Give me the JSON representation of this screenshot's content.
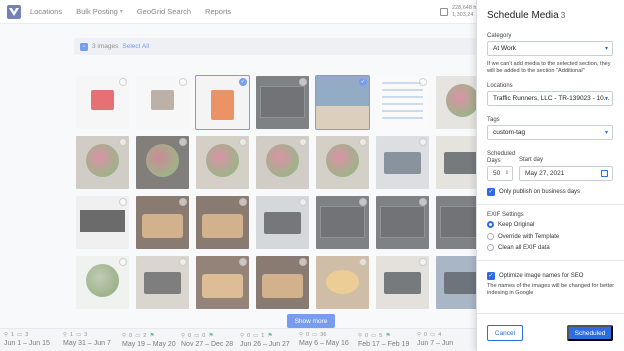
{
  "nav": {
    "items": [
      {
        "label": "Locations",
        "dropdown": false
      },
      {
        "label": "Bulk Posting",
        "dropdown": true
      },
      {
        "label": "GeoGrid Search",
        "dropdown": false
      },
      {
        "label": "Reports",
        "dropdown": false
      }
    ],
    "stat_line_1": "228,648 h",
    "stat_line_2": "1,303,24"
  },
  "selection": {
    "count_label": "3 images",
    "select_all_label": "Select All"
  },
  "media_grid": {
    "rows": [
      [
        {
          "subject": "red-top",
          "color": "#f2f2f2",
          "accent": "#d7262b",
          "selected": false
        },
        {
          "subject": "snake-print-top",
          "color": "#f3f3f3",
          "accent": "#9a8878",
          "selected": false
        },
        {
          "subject": "orange-skirt",
          "color": "#efefef",
          "accent": "#e05a14",
          "selected": true
        },
        {
          "subject": "video-dark",
          "color": "#3b3f44",
          "accent": "#26292d",
          "selected": false
        },
        {
          "subject": "landscape",
          "color": "#5a7fa6",
          "accent": "#c9b79a",
          "selected": true
        },
        {
          "subject": "infographic",
          "color": "#f7f7f9",
          "accent": "#7fa9d6",
          "selected": false
        },
        {
          "subject": "bouquet",
          "color": "#d9d6cf",
          "accent": "#c75a7a",
          "selected": false
        }
      ],
      [
        {
          "subject": "bouquet",
          "color": "#b8b3a8",
          "accent": "#c75a7a",
          "selected": false
        },
        {
          "subject": "bouquet-dark",
          "color": "#3e3a36",
          "accent": "#b04b5f",
          "selected": false
        },
        {
          "subject": "bouquet",
          "color": "#bdb7ab",
          "accent": "#c75a7a",
          "selected": false
        },
        {
          "subject": "bouquet",
          "color": "#b8b3a8",
          "accent": "#c75a7a",
          "selected": false
        },
        {
          "subject": "bouquet",
          "color": "#bdb7ab",
          "accent": "#c75a7a",
          "selected": false
        },
        {
          "subject": "desk-laptop",
          "color": "#c9ccd1",
          "accent": "#4a5a6a",
          "selected": false
        },
        {
          "subject": "laptop",
          "color": "#d8d4cc",
          "accent": "#2f3338",
          "selected": false
        }
      ],
      [
        {
          "subject": "logitech-keyboard",
          "color": "#e8e8e8",
          "accent": "#1c1c1c",
          "selected": false
        },
        {
          "subject": "typewriter",
          "color": "#4a3525",
          "accent": "#b9894f",
          "selected": false
        },
        {
          "subject": "typewriter",
          "color": "#4a3525",
          "accent": "#b9894f",
          "selected": false
        },
        {
          "subject": "laptops",
          "color": "#bfc3c8",
          "accent": "#2b2f34",
          "selected": false
        },
        {
          "subject": "video-dark",
          "color": "#3b3f44",
          "accent": "#26292d",
          "selected": false
        },
        {
          "subject": "video-dark",
          "color": "#3b3f44",
          "accent": "#26292d",
          "selected": false
        },
        {
          "subject": "video-dark",
          "color": "#3b3f44",
          "accent": "#26292d",
          "selected": false
        }
      ],
      [
        {
          "subject": "white-flowers",
          "color": "#e9ebe6",
          "accent": "#9fb092",
          "selected": false
        },
        {
          "subject": "desk-laptop",
          "color": "#c7bfb4",
          "accent": "#3a3a3a",
          "selected": false
        },
        {
          "subject": "typewriter",
          "color": "#5a4130",
          "accent": "#c99a5d",
          "selected": false
        },
        {
          "subject": "typewriter",
          "color": "#4a3525",
          "accent": "#b9894f",
          "selected": false
        },
        {
          "subject": "pastries",
          "color": "#b59a7a",
          "accent": "#e2b25c",
          "selected": false
        },
        {
          "subject": "laptop-hand",
          "color": "#d6d2cb",
          "accent": "#2f3338",
          "selected": false
        },
        {
          "subject": "laptop-blue",
          "color": "#7a8fa6",
          "accent": "#1f2a36",
          "selected": false
        }
      ]
    ]
  },
  "show_more_label": "Show more",
  "timeline": [
    {
      "stats": [
        "1",
        "3"
      ],
      "range": "Jun 1 – Jun 15",
      "flag": false
    },
    {
      "stats": [
        "1",
        "3"
      ],
      "range": "May 31 – Jun 7",
      "flag": false
    },
    {
      "stats": [
        "0",
        "2"
      ],
      "range": "May 19 – May 20",
      "flag": true
    },
    {
      "stats": [
        "0",
        "0"
      ],
      "range": "Nov 27 – Dec 28",
      "flag": true
    },
    {
      "stats": [
        "0",
        "1"
      ],
      "range": "Jun 26 – Jun 27",
      "flag": true
    },
    {
      "stats": [
        "0",
        "36"
      ],
      "range": "May 6 – May 16",
      "flag": false
    },
    {
      "stats": [
        "0",
        "5"
      ],
      "range": "Feb 17 – Feb 19",
      "flag": true
    },
    {
      "stats": [
        "0",
        "4"
      ],
      "range": "Jun 7 – Jun",
      "flag": false
    }
  ],
  "panel": {
    "title": "Schedule Media",
    "title_count": "3",
    "close_icon": "close-icon",
    "category_label": "Category",
    "category_value": "At Work",
    "category_note": "If we can't add media to the selected section, they will be added to the section \"Additional\"",
    "locations_label": "Locations",
    "locations_value": "Traffic Runners, LLC - TR-139023 - 10...",
    "tags_label": "Tags",
    "tags_value": "custom-tag",
    "scheduled_label": "Scheduled",
    "days_label": "Days",
    "days_value": "50",
    "start_day_label": "Start day",
    "start_day_value": "May 27, 2021",
    "business_days_label": "Only publish on business days",
    "business_days_checked": true,
    "exif_label": "EXIF Settings",
    "exif_options": [
      {
        "label": "Keep Original",
        "checked": true
      },
      {
        "label": "Override with Template",
        "checked": false
      },
      {
        "label": "Clean all EXIF data",
        "checked": false
      }
    ],
    "optimize_label": "Optimize image names for SEO",
    "optimize_checked": true,
    "optimize_note": "The names of the images will be changed for better indexing in Google",
    "cancel_label": "Cancel",
    "submit_label": "Scheduled"
  },
  "colors": {
    "accent": "#2d6be4",
    "flag": "#1fa463"
  }
}
